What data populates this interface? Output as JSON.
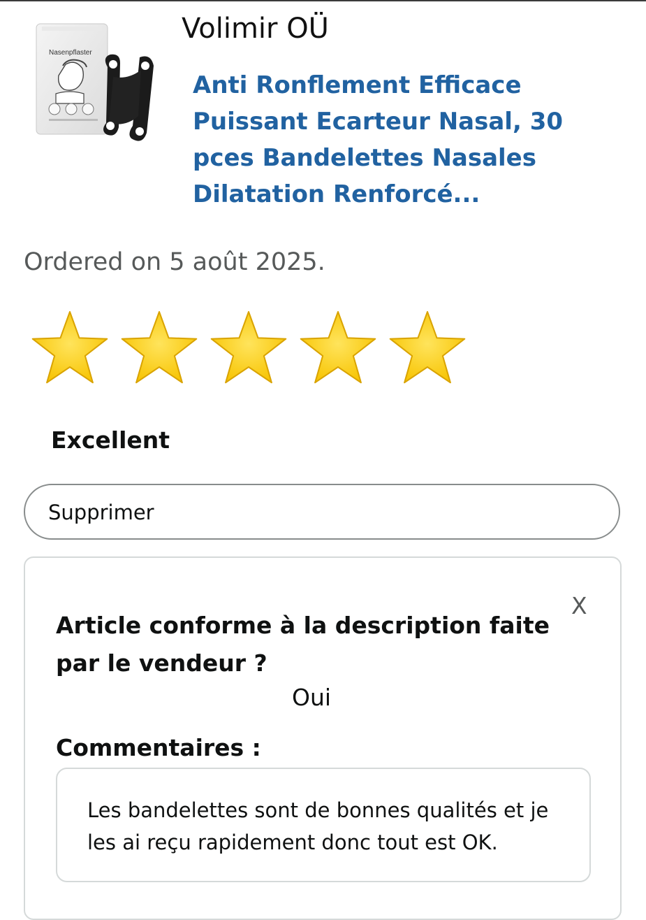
{
  "seller": {
    "name": "Volimir OÜ"
  },
  "product": {
    "title": "Anti Ronflement Efficace Puissant Ecarteur Nasal, 30 pces Bandelettes Nasales Dilatation Renforcé...",
    "image_label": "Nasenpflaster"
  },
  "order": {
    "ordered_text": "Ordered on 5 août 2025."
  },
  "rating": {
    "stars": 5,
    "max_stars": 5,
    "label": "Excellent",
    "star_color": "#f7c300"
  },
  "actions": {
    "delete_label": "Supprimer"
  },
  "feedback_card": {
    "close_label": "X",
    "question": "Article conforme à la description faite par le vendeur ?",
    "answer": "Oui",
    "comments_label": "Commentaires :",
    "comment": "Les bandelettes sont de bonnes qualités et je les ai reçu rapidement donc tout est OK."
  },
  "colors": {
    "link": "#2162a1",
    "muted_text": "#565959",
    "border": "#d5d9d9"
  }
}
